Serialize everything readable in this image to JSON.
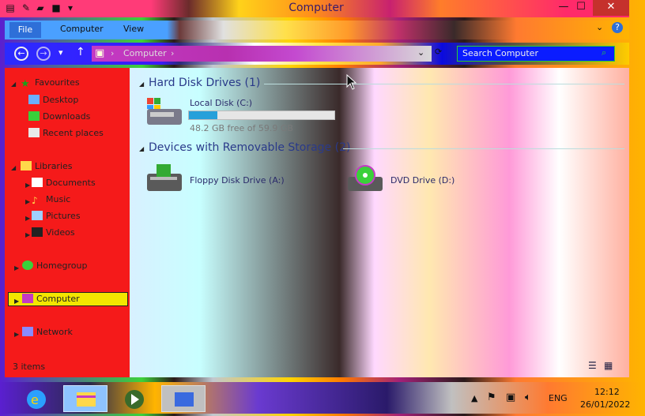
{
  "window": {
    "title": "Computer",
    "controls": {
      "minimize": "—",
      "maximize": "☐",
      "close": "✕"
    }
  },
  "ribbon": {
    "tabs": [
      "File",
      "Computer",
      "View"
    ],
    "collapse_glyph": "⌄",
    "help_glyph": "?"
  },
  "address": {
    "path": "Computer",
    "separator": "›",
    "search_placeholder": "Search Computer"
  },
  "nav": {
    "favourites": {
      "label": "Favourites",
      "items": [
        "Desktop",
        "Downloads",
        "Recent places"
      ]
    },
    "libraries": {
      "label": "Libraries",
      "items": [
        "Documents",
        "Music",
        "Pictures",
        "Videos"
      ]
    },
    "homegroup": "Homegroup",
    "computer": "Computer",
    "network": "Network"
  },
  "status": {
    "items": "3 items"
  },
  "content": {
    "groups": [
      {
        "title": "Hard Disk Drives (1)",
        "drives": [
          {
            "name": "Local Disk (C:)",
            "free": "48.2 GB free of 59.9 GB",
            "used_fraction": 0.195
          }
        ]
      },
      {
        "title": "Devices with Removable Storage (2)",
        "drives": [
          {
            "name": "Floppy Disk Drive (A:)"
          },
          {
            "name": "DVD Drive (D:)"
          }
        ]
      }
    ]
  },
  "taskbar": {
    "language": "ENG",
    "time": "12:12",
    "date": "26/01/2022"
  },
  "colors": {
    "selection": "#f3e600",
    "close": "#c5312c",
    "progress": "#26a0da"
  }
}
